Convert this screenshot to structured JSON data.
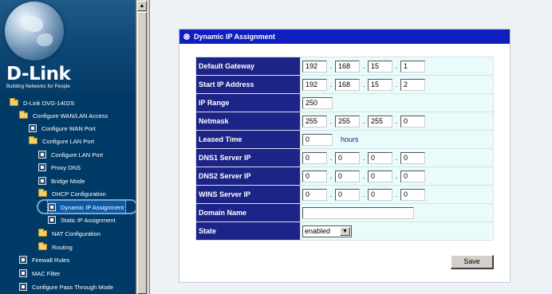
{
  "nav": {
    "brand": "D-Link",
    "tagline": "Building Networks for People",
    "tree": [
      {
        "label": "D-Link DVG-1402S",
        "icon": "folder-open-icon"
      },
      {
        "label": "Configure WAN/LAN Access",
        "icon": "folder-open-icon"
      },
      {
        "label": "Configure WAN Port",
        "icon": "page-icon"
      },
      {
        "label": "Configure LAN Port",
        "icon": "folder-open-icon"
      },
      {
        "label": "Configure LAN Port",
        "icon": "page-icon"
      },
      {
        "label": "Proxy DNS",
        "icon": "page-icon"
      },
      {
        "label": "Bridge Mode",
        "icon": "page-icon"
      },
      {
        "label": "DHCP Configuration",
        "icon": "folder-open-icon"
      },
      {
        "label": "Dynamic IP Assignment",
        "icon": "page-icon",
        "selected": true
      },
      {
        "label": "Static IP Assignment",
        "icon": "page-icon"
      },
      {
        "label": "NAT Configuration",
        "icon": "folder-icon"
      },
      {
        "label": "Routing",
        "icon": "folder-icon"
      },
      {
        "label": "Firewall Rules",
        "icon": "page-icon"
      },
      {
        "label": "MAC Filter",
        "icon": "page-icon"
      },
      {
        "label": "Configure Pass Through Mode",
        "icon": "page-icon"
      }
    ]
  },
  "scrollbar": {
    "up_arrow": "▲"
  },
  "panel": {
    "title": "Dynamic IP Assignment",
    "title_icon": "network-icon",
    "header_color": "#0f1fbf"
  },
  "form": {
    "default_gateway": {
      "label": "Default Gateway",
      "octets": [
        "192",
        "168",
        "15",
        "1"
      ]
    },
    "start_ip": {
      "label": "Start IP Address",
      "octets": [
        "192",
        "168",
        "15",
        "2"
      ]
    },
    "ip_range": {
      "label": "IP Range",
      "value": "250"
    },
    "netmask": {
      "label": "Netmask",
      "octets": [
        "255",
        "255",
        "255",
        "0"
      ]
    },
    "leased_time": {
      "label": "Leased Time",
      "value": "0",
      "unit": "hours"
    },
    "dns1": {
      "label": "DNS1 Server IP",
      "octets": [
        "0",
        "0",
        "0",
        "0"
      ]
    },
    "dns2": {
      "label": "DNS2 Server IP",
      "octets": [
        "0",
        "0",
        "0",
        "0"
      ]
    },
    "wins": {
      "label": "WINS Server IP",
      "octets": [
        "0",
        "0",
        "0",
        "0"
      ]
    },
    "domain_name": {
      "label": "Domain Name",
      "value": ""
    },
    "state": {
      "label": "State",
      "value": "enabled",
      "arrow": "▼"
    }
  },
  "actions": {
    "save_label": "Save"
  },
  "colors": {
    "label_bg": "#1d2488",
    "value_bg": "#e9fbfb",
    "nav_bg": "#003a66"
  }
}
